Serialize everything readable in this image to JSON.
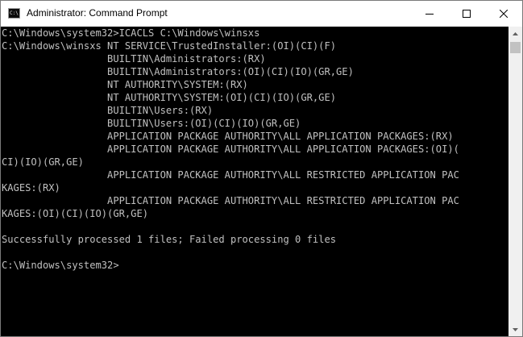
{
  "window": {
    "title": "Administrator: Command Prompt",
    "icon": "console-icon",
    "icon_glyph": "C:\\",
    "controls": {
      "minimize": "minimize-icon",
      "maximize": "maximize-icon",
      "close": "close-icon"
    }
  },
  "console": {
    "colors": {
      "background": "#000000",
      "foreground": "#c0c0c0"
    },
    "lines": [
      "C:\\Windows\\system32>ICACLS C:\\Windows\\winsxs",
      "C:\\Windows\\winsxs NT SERVICE\\TrustedInstaller:(OI)(CI)(F)",
      "                  BUILTIN\\Administrators:(RX)",
      "                  BUILTIN\\Administrators:(OI)(CI)(IO)(GR,GE)",
      "                  NT AUTHORITY\\SYSTEM:(RX)",
      "                  NT AUTHORITY\\SYSTEM:(OI)(CI)(IO)(GR,GE)",
      "                  BUILTIN\\Users:(RX)",
      "                  BUILTIN\\Users:(OI)(CI)(IO)(GR,GE)",
      "                  APPLICATION PACKAGE AUTHORITY\\ALL APPLICATION PACKAGES:(RX)",
      "                  APPLICATION PACKAGE AUTHORITY\\ALL APPLICATION PACKAGES:(OI)(",
      "CI)(IO)(GR,GE)",
      "                  APPLICATION PACKAGE AUTHORITY\\ALL RESTRICTED APPLICATION PAC",
      "KAGES:(RX)",
      "                  APPLICATION PACKAGE AUTHORITY\\ALL RESTRICTED APPLICATION PAC",
      "KAGES:(OI)(CI)(IO)(GR,GE)",
      "",
      "Successfully processed 1 files; Failed processing 0 files",
      "",
      "C:\\Windows\\system32>"
    ]
  },
  "scrollbar": {
    "up": "scroll-up-arrow-icon",
    "down": "scroll-down-arrow-icon"
  }
}
